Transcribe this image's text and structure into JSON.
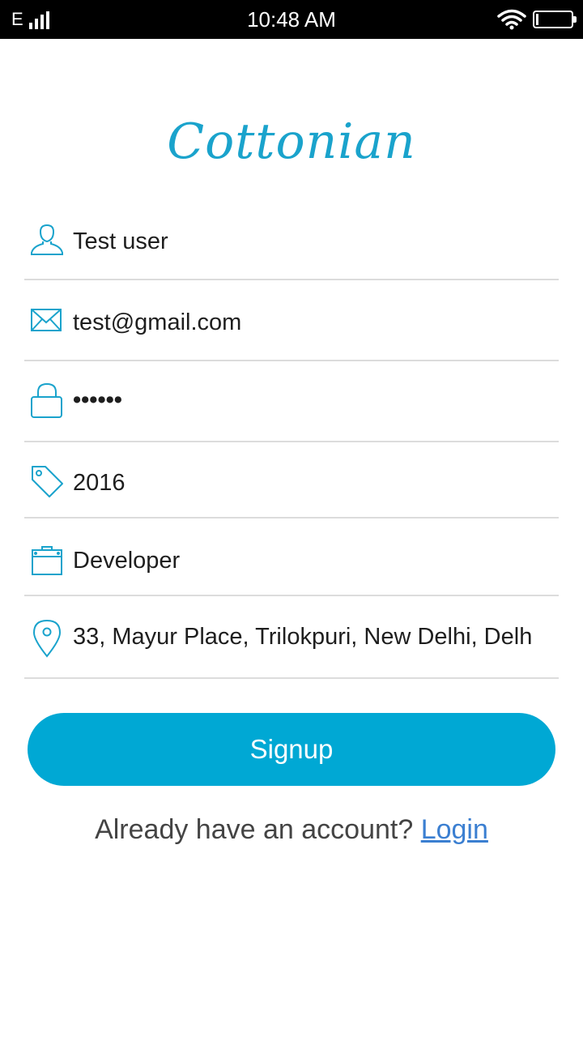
{
  "status_bar": {
    "network": "E",
    "time": "10:48 AM"
  },
  "app": {
    "logo": "Cottonian"
  },
  "form": {
    "name": {
      "icon": "user-icon",
      "value": "Test user"
    },
    "email": {
      "icon": "envelope-icon",
      "value": "test@gmail.com"
    },
    "password": {
      "icon": "lock-icon",
      "value": "••••••"
    },
    "year": {
      "icon": "tag-icon",
      "value": "2016"
    },
    "profession": {
      "icon": "briefcase-icon",
      "value": "Developer"
    },
    "address": {
      "icon": "location-pin-icon",
      "value": "33, Mayur Place, Trilokpuri, New Delhi, Delh"
    }
  },
  "actions": {
    "signup_label": "Signup",
    "already_text": "Already have an account?",
    "login_label": "Login"
  },
  "colors": {
    "accent": "#00a8d4",
    "logo": "#1aa3cc",
    "link": "#3b7fd1",
    "divider": "#dcdcdc"
  }
}
